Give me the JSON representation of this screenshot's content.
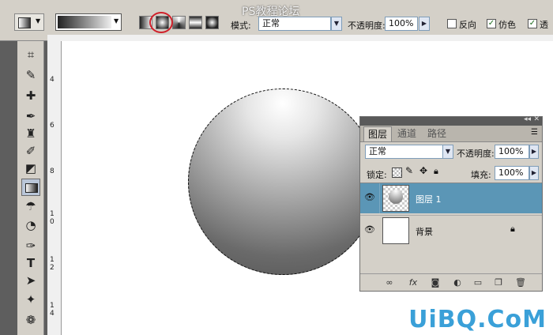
{
  "options_bar": {
    "site_watermark": "PS教程论坛",
    "mode_label": "模式:",
    "mode_value": "正常",
    "opacity_label": "不透明度:",
    "opacity_value": "100%",
    "reverse_label": "反向",
    "reverse_checked": false,
    "dither_label": "仿色",
    "dither_checked": true,
    "transparency_label": "透"
  },
  "rulers": {
    "vertical_numbers": [
      "4",
      "6",
      "8",
      "1\n0",
      "1\n2",
      "1\n4"
    ]
  },
  "layers_panel": {
    "tabs": [
      {
        "label": "图层",
        "active": true
      },
      {
        "label": "通道",
        "active": false
      },
      {
        "label": "路径",
        "active": false
      }
    ],
    "blend_mode": "正常",
    "opacity_label": "不透明度:",
    "opacity_value": "100%",
    "lock_label": "锁定:",
    "fill_label": "填充:",
    "fill_value": "100%",
    "layers": [
      {
        "name": "图层 1",
        "selected": true,
        "locked": false
      },
      {
        "name": "背景",
        "selected": false,
        "locked": true
      }
    ],
    "footer_icons": [
      "link-icon",
      "fx-icon",
      "mask-icon",
      "adjustment-icon",
      "group-icon",
      "new-layer-icon",
      "trash-icon"
    ]
  },
  "watermark": {
    "logo": "UiBQ.CoM"
  },
  "colors": {
    "selected_layer": "#5b96b6",
    "ui_gray": "#d4d0c8",
    "highlight_circle": "#d0202a",
    "logo_blue": "#3aa0d8"
  }
}
